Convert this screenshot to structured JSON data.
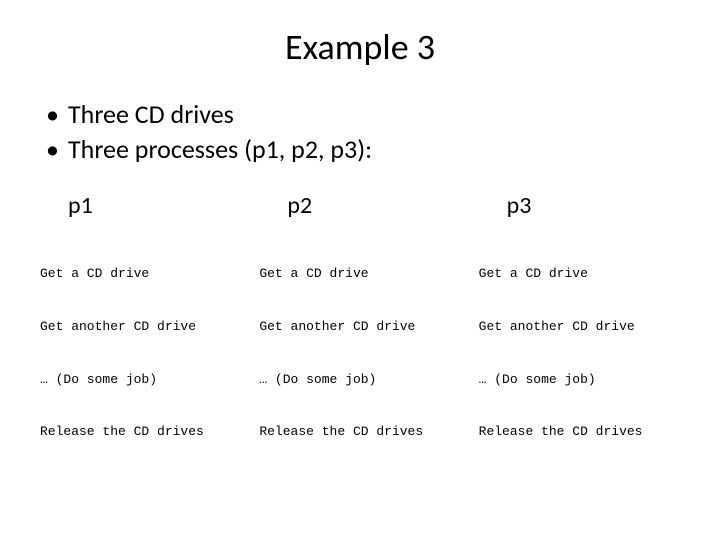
{
  "title": "Example 3",
  "bullets": [
    "Three CD drives",
    "Three processes (p1, p2, p3):"
  ],
  "columns": [
    {
      "heading": "p1",
      "lines": [
        "Get a CD drive",
        "Get another CD drive",
        "… (Do some job)",
        "Release the CD drives"
      ]
    },
    {
      "heading": "p2",
      "lines": [
        "Get a CD drive",
        "Get another CD drive",
        "… (Do some job)",
        "Release the CD drives"
      ]
    },
    {
      "heading": "p3",
      "lines": [
        "Get a CD drive",
        "Get another CD drive",
        "… (Do some job)",
        "Release the CD drives"
      ]
    }
  ]
}
